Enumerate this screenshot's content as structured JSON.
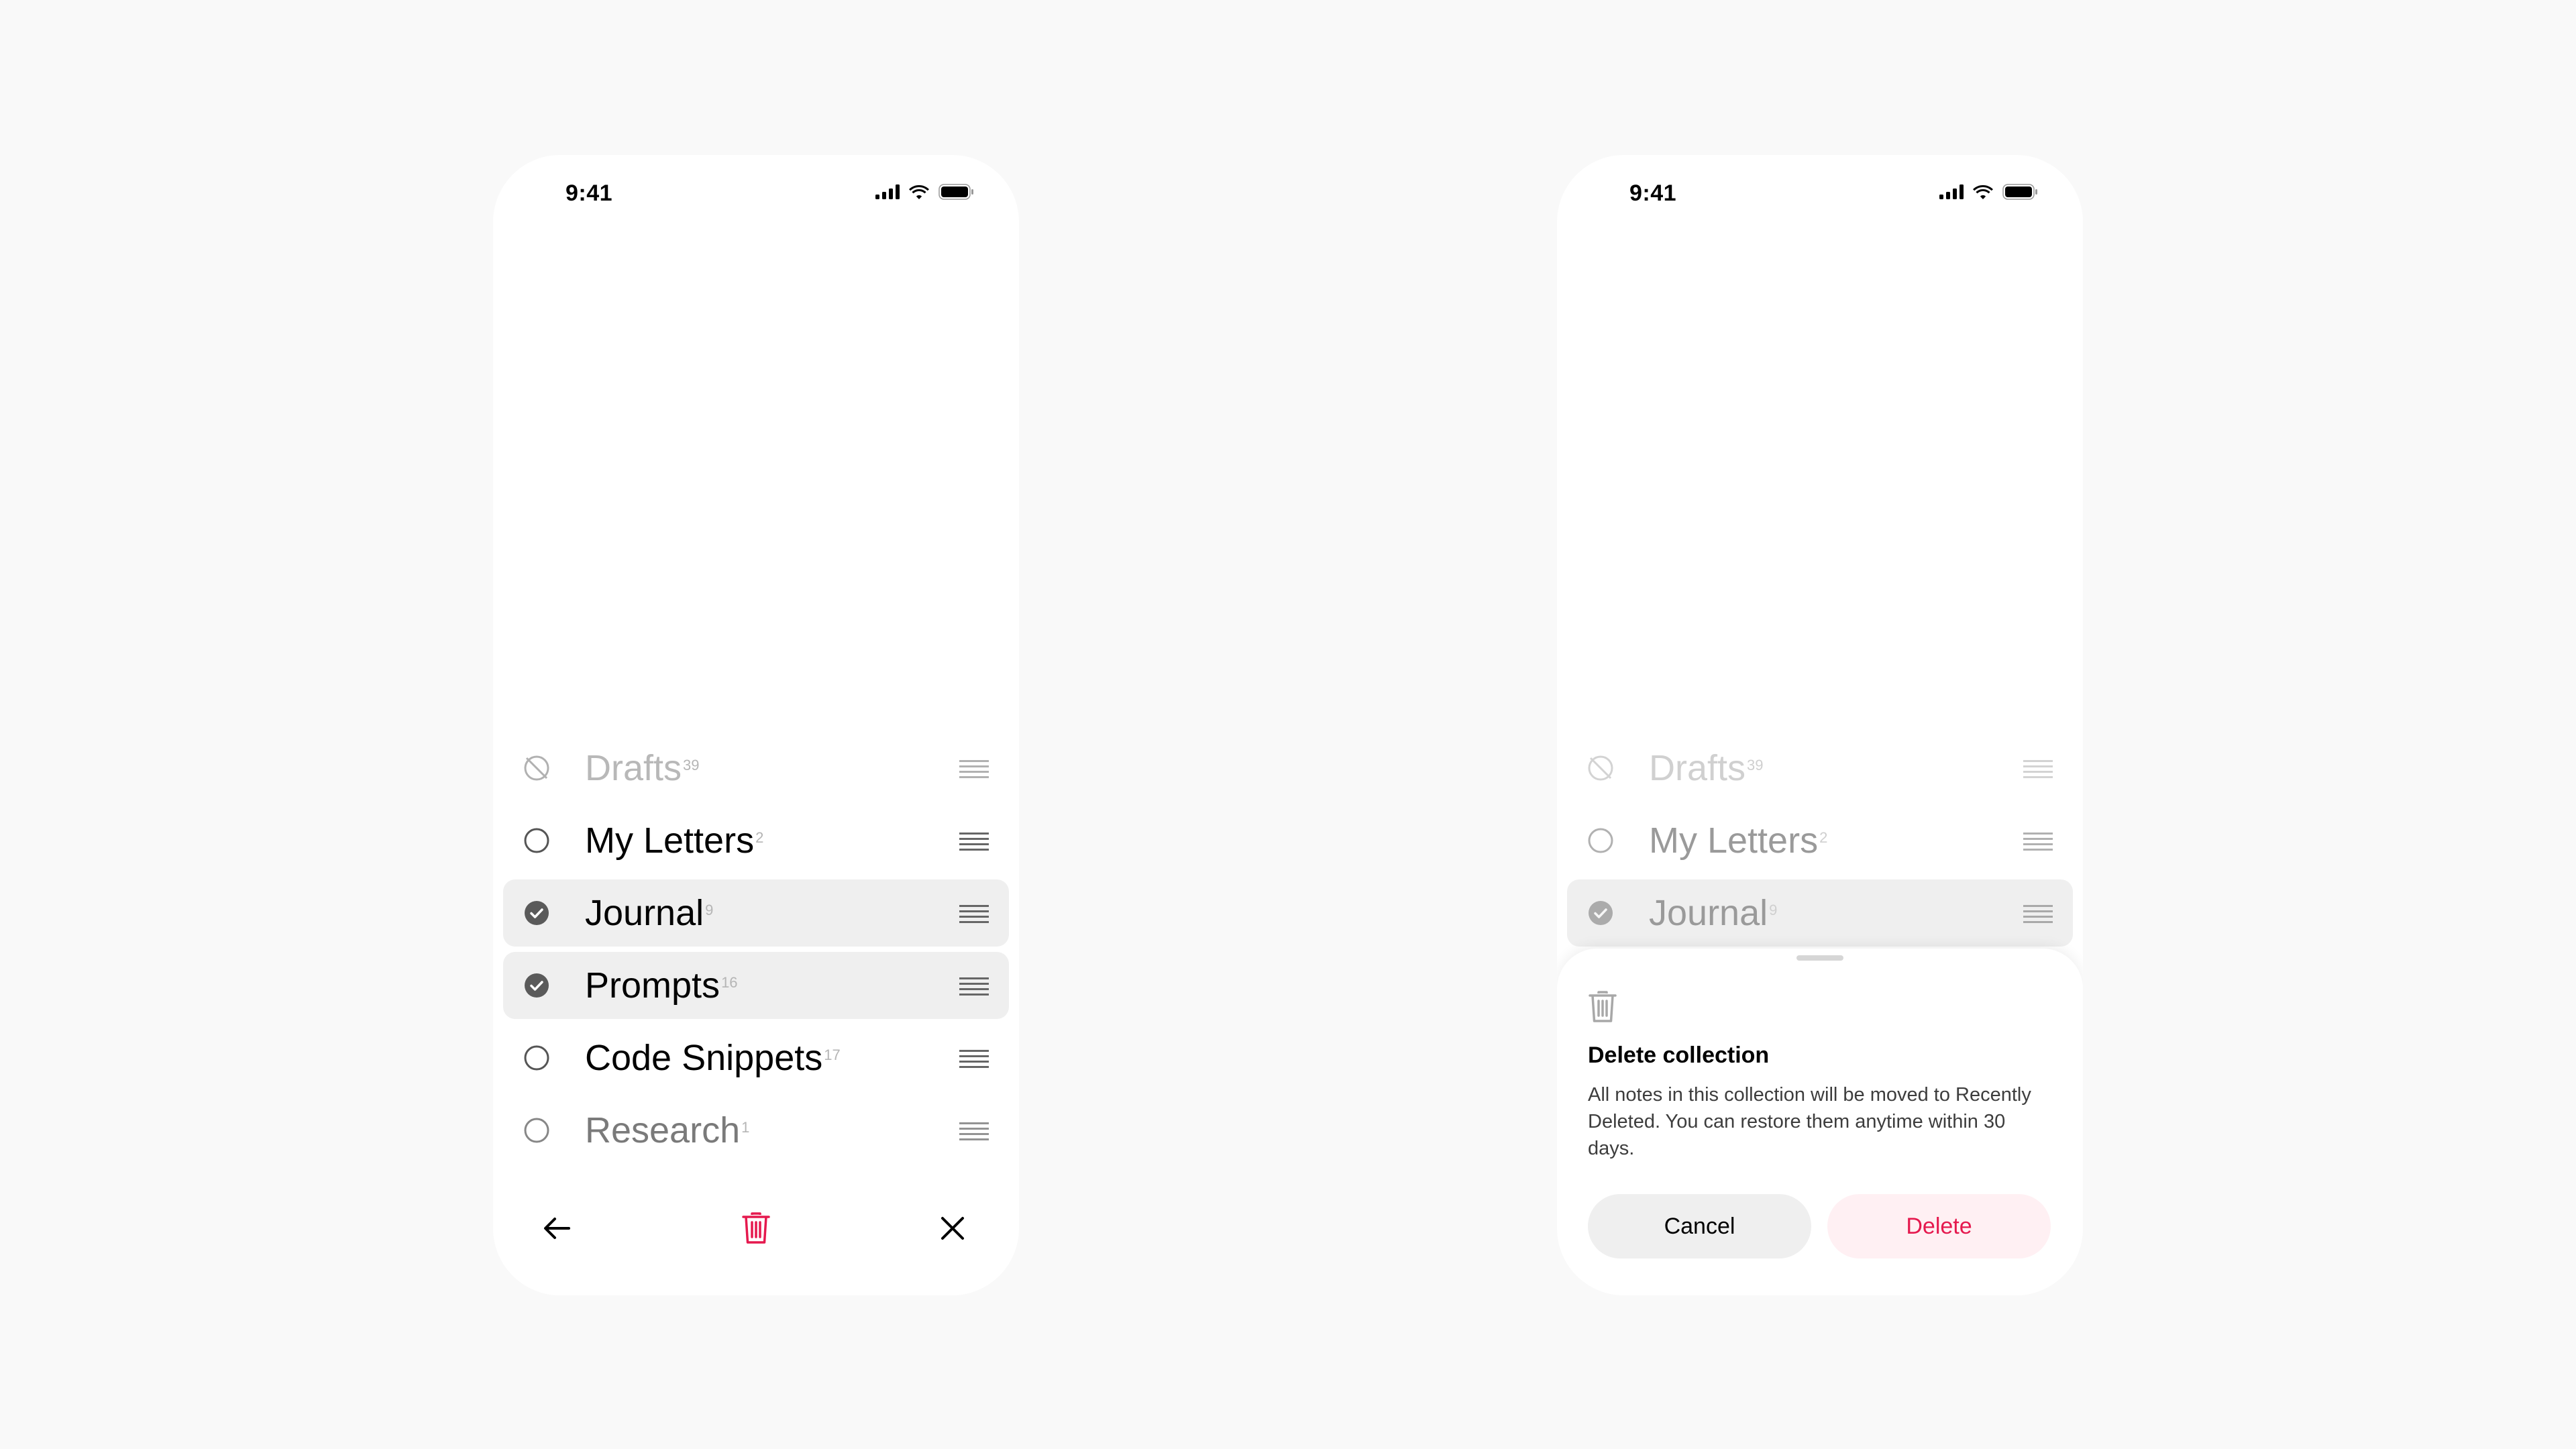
{
  "status": {
    "time": "9:41"
  },
  "collections": [
    {
      "name": "Drafts",
      "count": "39",
      "selected": false
    },
    {
      "name": "My Letters",
      "count": "2",
      "selected": false
    },
    {
      "name": "Journal",
      "count": "9",
      "selected": true
    },
    {
      "name": "Prompts",
      "count": "16",
      "selected": true
    },
    {
      "name": "Code Snippets",
      "count": "17",
      "selected": false
    },
    {
      "name": "Research",
      "count": "1",
      "selected": false
    }
  ],
  "toolbar": {
    "back": "arrow-left-icon",
    "delete": "trash-icon",
    "close": "close-icon"
  },
  "dialog": {
    "title": "Delete collection",
    "message": "All notes in this collection will be moved to Recently Deleted. You can restore them anytime within 30 days.",
    "cancel_label": "Cancel",
    "delete_label": "Delete"
  },
  "colors": {
    "destructive": "#e5194e",
    "selected_row": "#efefef",
    "destructive_bg": "#fff0f3"
  }
}
